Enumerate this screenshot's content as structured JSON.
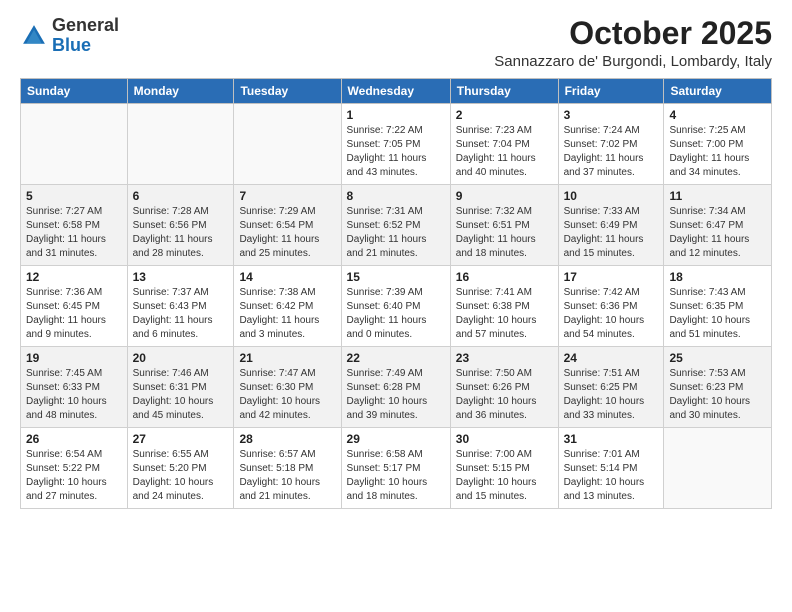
{
  "logo": {
    "general": "General",
    "blue": "Blue"
  },
  "title": "October 2025",
  "location": "Sannazzaro de' Burgondi, Lombardy, Italy",
  "days_of_week": [
    "Sunday",
    "Monday",
    "Tuesday",
    "Wednesday",
    "Thursday",
    "Friday",
    "Saturday"
  ],
  "weeks": [
    [
      {
        "day": "",
        "info": ""
      },
      {
        "day": "",
        "info": ""
      },
      {
        "day": "",
        "info": ""
      },
      {
        "day": "1",
        "info": "Sunrise: 7:22 AM\nSunset: 7:05 PM\nDaylight: 11 hours\nand 43 minutes."
      },
      {
        "day": "2",
        "info": "Sunrise: 7:23 AM\nSunset: 7:04 PM\nDaylight: 11 hours\nand 40 minutes."
      },
      {
        "day": "3",
        "info": "Sunrise: 7:24 AM\nSunset: 7:02 PM\nDaylight: 11 hours\nand 37 minutes."
      },
      {
        "day": "4",
        "info": "Sunrise: 7:25 AM\nSunset: 7:00 PM\nDaylight: 11 hours\nand 34 minutes."
      }
    ],
    [
      {
        "day": "5",
        "info": "Sunrise: 7:27 AM\nSunset: 6:58 PM\nDaylight: 11 hours\nand 31 minutes."
      },
      {
        "day": "6",
        "info": "Sunrise: 7:28 AM\nSunset: 6:56 PM\nDaylight: 11 hours\nand 28 minutes."
      },
      {
        "day": "7",
        "info": "Sunrise: 7:29 AM\nSunset: 6:54 PM\nDaylight: 11 hours\nand 25 minutes."
      },
      {
        "day": "8",
        "info": "Sunrise: 7:31 AM\nSunset: 6:52 PM\nDaylight: 11 hours\nand 21 minutes."
      },
      {
        "day": "9",
        "info": "Sunrise: 7:32 AM\nSunset: 6:51 PM\nDaylight: 11 hours\nand 18 minutes."
      },
      {
        "day": "10",
        "info": "Sunrise: 7:33 AM\nSunset: 6:49 PM\nDaylight: 11 hours\nand 15 minutes."
      },
      {
        "day": "11",
        "info": "Sunrise: 7:34 AM\nSunset: 6:47 PM\nDaylight: 11 hours\nand 12 minutes."
      }
    ],
    [
      {
        "day": "12",
        "info": "Sunrise: 7:36 AM\nSunset: 6:45 PM\nDaylight: 11 hours\nand 9 minutes."
      },
      {
        "day": "13",
        "info": "Sunrise: 7:37 AM\nSunset: 6:43 PM\nDaylight: 11 hours\nand 6 minutes."
      },
      {
        "day": "14",
        "info": "Sunrise: 7:38 AM\nSunset: 6:42 PM\nDaylight: 11 hours\nand 3 minutes."
      },
      {
        "day": "15",
        "info": "Sunrise: 7:39 AM\nSunset: 6:40 PM\nDaylight: 11 hours\nand 0 minutes."
      },
      {
        "day": "16",
        "info": "Sunrise: 7:41 AM\nSunset: 6:38 PM\nDaylight: 10 hours\nand 57 minutes."
      },
      {
        "day": "17",
        "info": "Sunrise: 7:42 AM\nSunset: 6:36 PM\nDaylight: 10 hours\nand 54 minutes."
      },
      {
        "day": "18",
        "info": "Sunrise: 7:43 AM\nSunset: 6:35 PM\nDaylight: 10 hours\nand 51 minutes."
      }
    ],
    [
      {
        "day": "19",
        "info": "Sunrise: 7:45 AM\nSunset: 6:33 PM\nDaylight: 10 hours\nand 48 minutes."
      },
      {
        "day": "20",
        "info": "Sunrise: 7:46 AM\nSunset: 6:31 PM\nDaylight: 10 hours\nand 45 minutes."
      },
      {
        "day": "21",
        "info": "Sunrise: 7:47 AM\nSunset: 6:30 PM\nDaylight: 10 hours\nand 42 minutes."
      },
      {
        "day": "22",
        "info": "Sunrise: 7:49 AM\nSunset: 6:28 PM\nDaylight: 10 hours\nand 39 minutes."
      },
      {
        "day": "23",
        "info": "Sunrise: 7:50 AM\nSunset: 6:26 PM\nDaylight: 10 hours\nand 36 minutes."
      },
      {
        "day": "24",
        "info": "Sunrise: 7:51 AM\nSunset: 6:25 PM\nDaylight: 10 hours\nand 33 minutes."
      },
      {
        "day": "25",
        "info": "Sunrise: 7:53 AM\nSunset: 6:23 PM\nDaylight: 10 hours\nand 30 minutes."
      }
    ],
    [
      {
        "day": "26",
        "info": "Sunrise: 6:54 AM\nSunset: 5:22 PM\nDaylight: 10 hours\nand 27 minutes."
      },
      {
        "day": "27",
        "info": "Sunrise: 6:55 AM\nSunset: 5:20 PM\nDaylight: 10 hours\nand 24 minutes."
      },
      {
        "day": "28",
        "info": "Sunrise: 6:57 AM\nSunset: 5:18 PM\nDaylight: 10 hours\nand 21 minutes."
      },
      {
        "day": "29",
        "info": "Sunrise: 6:58 AM\nSunset: 5:17 PM\nDaylight: 10 hours\nand 18 minutes."
      },
      {
        "day": "30",
        "info": "Sunrise: 7:00 AM\nSunset: 5:15 PM\nDaylight: 10 hours\nand 15 minutes."
      },
      {
        "day": "31",
        "info": "Sunrise: 7:01 AM\nSunset: 5:14 PM\nDaylight: 10 hours\nand 13 minutes."
      },
      {
        "day": "",
        "info": ""
      }
    ]
  ],
  "colors": {
    "header_bg": "#2a6db5",
    "header_text": "#ffffff",
    "shaded_row": "#f2f2f2"
  }
}
